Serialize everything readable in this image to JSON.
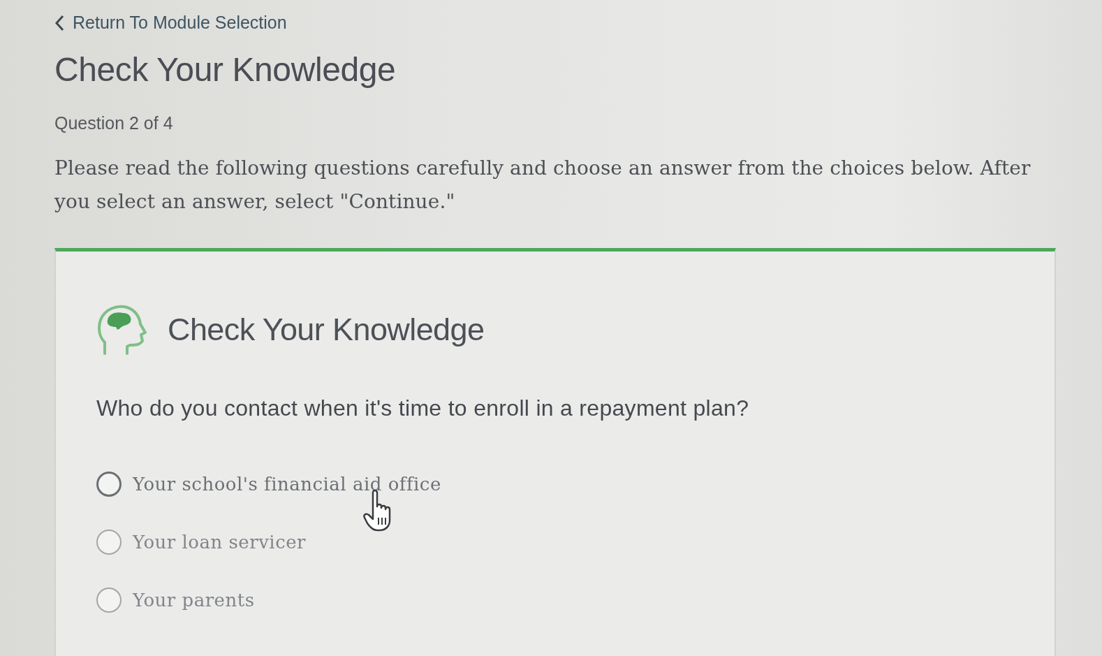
{
  "back_link": {
    "label": "Return To Module Selection"
  },
  "page_title": "Check Your Knowledge",
  "progress": "Question 2 of 4",
  "instructions": "Please read the following questions carefully and choose an answer from the choices below. After you select an answer, select \"Continue.\"",
  "card": {
    "title": "Check Your Knowledge",
    "question": "Who do you contact when it's time to enroll in a repayment plan?",
    "options": [
      {
        "label": "Your school's financial aid office",
        "selected": false,
        "hovered": true
      },
      {
        "label": "Your loan servicer",
        "selected": false,
        "hovered": false
      },
      {
        "label": "Your parents",
        "selected": false,
        "hovered": false
      }
    ]
  }
}
